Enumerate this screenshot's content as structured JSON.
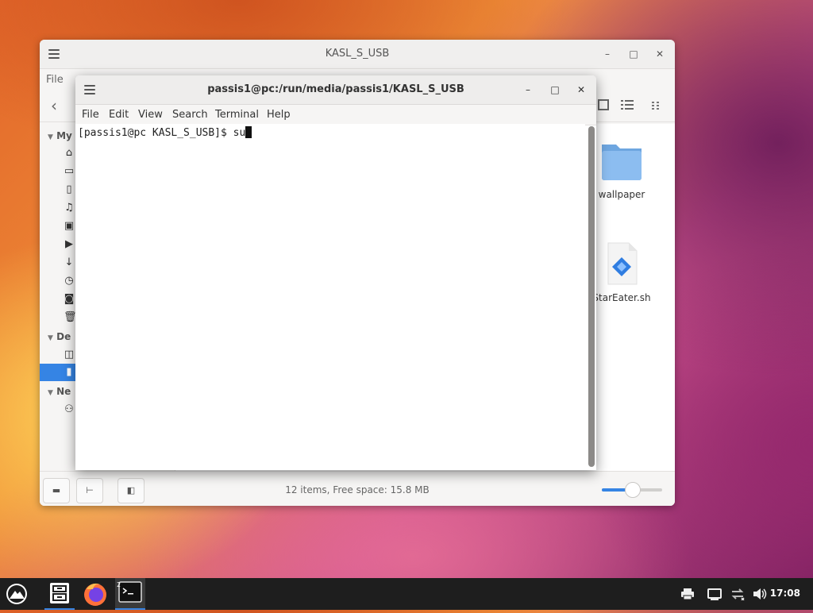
{
  "file_manager": {
    "title": "KASL_S_USB",
    "menu_file": "File",
    "minimize": "–",
    "maximize": "□",
    "close": "✕",
    "sidebar": {
      "headers": [
        {
          "label": "My"
        },
        {
          "label": "De"
        },
        {
          "label": "Ne"
        }
      ]
    },
    "files": [
      {
        "name": "wallpaper",
        "icon": "folder-icon"
      },
      {
        "name": "StarEater.sh",
        "icon": "script-icon"
      }
    ],
    "status_text": "12 items, Free space: 15.8 MB",
    "zoom_level": 0.5,
    "colors": {
      "accent": "#3584e4",
      "folder": "#7fb2e5"
    }
  },
  "terminal": {
    "title": "passis1@pc:/run/media/passis1/KASL_S_USB",
    "menu": [
      "File",
      "Edit",
      "View",
      "Search",
      "Terminal",
      "Help"
    ],
    "prompt": "[passis1@pc KASL_S_USB]$ ",
    "command": "su",
    "minimize": "–",
    "maximize": "□",
    "close": "✕"
  },
  "taskbar": {
    "clock": "17:08",
    "apps": [
      "app-menu-icon",
      "file-manager-icon",
      "firefox-icon",
      "terminal-icon"
    ],
    "tray": [
      "printer-icon",
      "display-icon",
      "network-icon",
      "volume-icon"
    ]
  }
}
